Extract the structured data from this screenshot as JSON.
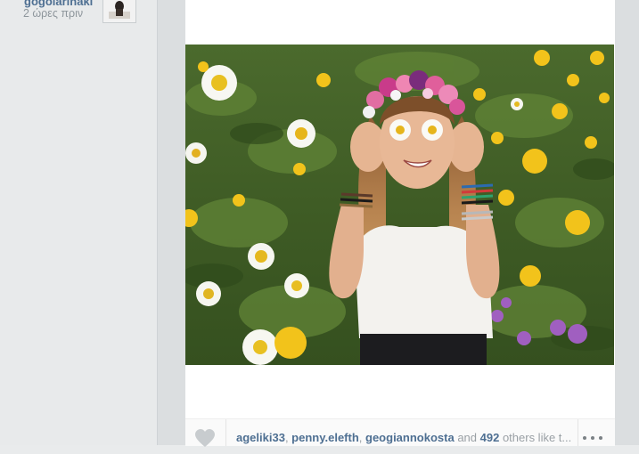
{
  "notification": {
    "username": "gogolarinaki",
    "timestamp": "2 ώρες πριν",
    "thumbnail_icon": "user-photo-thumbnail"
  },
  "post": {
    "photo_icon": "post-photo",
    "likes": {
      "likers": [
        "ageliki33",
        "penny.elefth",
        "geogiannokosta"
      ],
      "separator": ", ",
      "conjunction": " and ",
      "count": "492",
      "suffix": " others like t..."
    },
    "like_icon": "heart-icon",
    "more_icon": "more-options-icon"
  },
  "colors": {
    "link": "#4e6f92",
    "muted": "#9aa0a5",
    "panel_bg": "#e8eaeb",
    "card_bg": "#ffffff"
  }
}
